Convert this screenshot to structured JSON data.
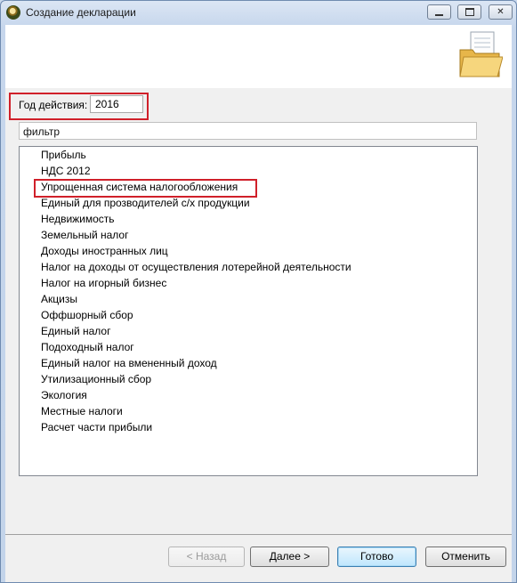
{
  "window": {
    "title": "Создание декларации"
  },
  "form": {
    "year_label": "Год действия:",
    "year_value": "2016",
    "filter_placeholder": "фильтр"
  },
  "list": {
    "items": [
      "Прибыль",
      "НДС 2012",
      "Упрощенная система налогообложения",
      "Единый для прозводителей с/х продукции",
      "Недвижимость",
      "Земельный налог",
      "Доходы иностранных лиц",
      "Налог на доходы от осуществления лотерейной деятельности",
      "Налог на игорный бизнес",
      "Акцизы",
      "Оффшорный сбор",
      "Единый налог",
      "Подоходный налог",
      "Единый налог на вмененный доход",
      "Утилизационный сбор",
      "Экология",
      "Местные налоги",
      "Расчет части прибыли"
    ],
    "highlighted_index": 2
  },
  "footer": {
    "back_label": "< Назад",
    "next_label": "Далее >",
    "done_label": "Готово",
    "cancel_label": "Отменить"
  },
  "colors": {
    "highlight_border": "#d0202a",
    "default_button": "#3c7fb1"
  }
}
